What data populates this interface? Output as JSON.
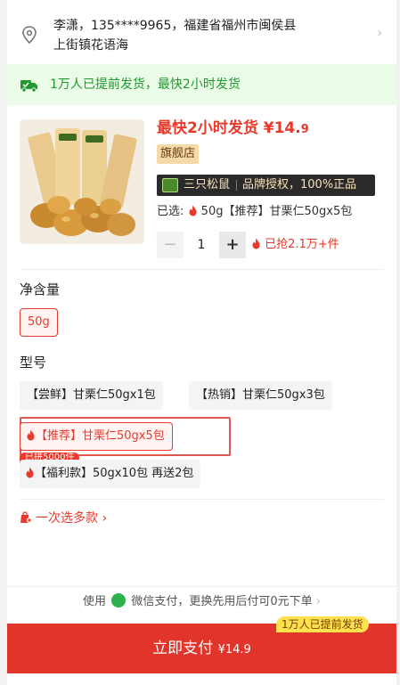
{
  "address": {
    "line1": "李潇，135****9965，福建省福州市闽侯县",
    "line2": "上街镇花语海"
  },
  "shipping_banner": "1万人已提前发货，最快2小时发货",
  "product": {
    "price_prefix": "最快2小时发货 ¥14.",
    "price_decimal": "9",
    "store_badge": "旗舰店",
    "brand_name": "三只松鼠",
    "brand_auth": "品牌授权，100%正品",
    "selected_label": "已选:",
    "selected_value": "50g【推荐】甘栗仁50gx5包",
    "quantity": "1",
    "minus": "−",
    "plus": "+",
    "sold": "已抢2.1万+件"
  },
  "specs": {
    "net_title": "净含量",
    "net_options": [
      "50g"
    ],
    "model_title": "型号",
    "model_options": [
      "【尝鲜】甘栗仁50gx1包",
      "【热销】甘栗仁50gx3包",
      "【推荐】甘栗仁50gx5包",
      "【福利款】50gx10包 再送2包"
    ],
    "badge": "已拼5000件",
    "multi_select": "一次选多款"
  },
  "footer": {
    "pay_note_pre": "使用",
    "pay_note_post": "微信支付，更换先用后付可0元下单",
    "cta_tag": "1万人已提前发货",
    "cta_label": "立即支付 ",
    "cta_price": "¥14.",
    "cta_decimal": "9"
  },
  "colors": {
    "accent": "#e1352b",
    "green": "#1f9a2e"
  }
}
